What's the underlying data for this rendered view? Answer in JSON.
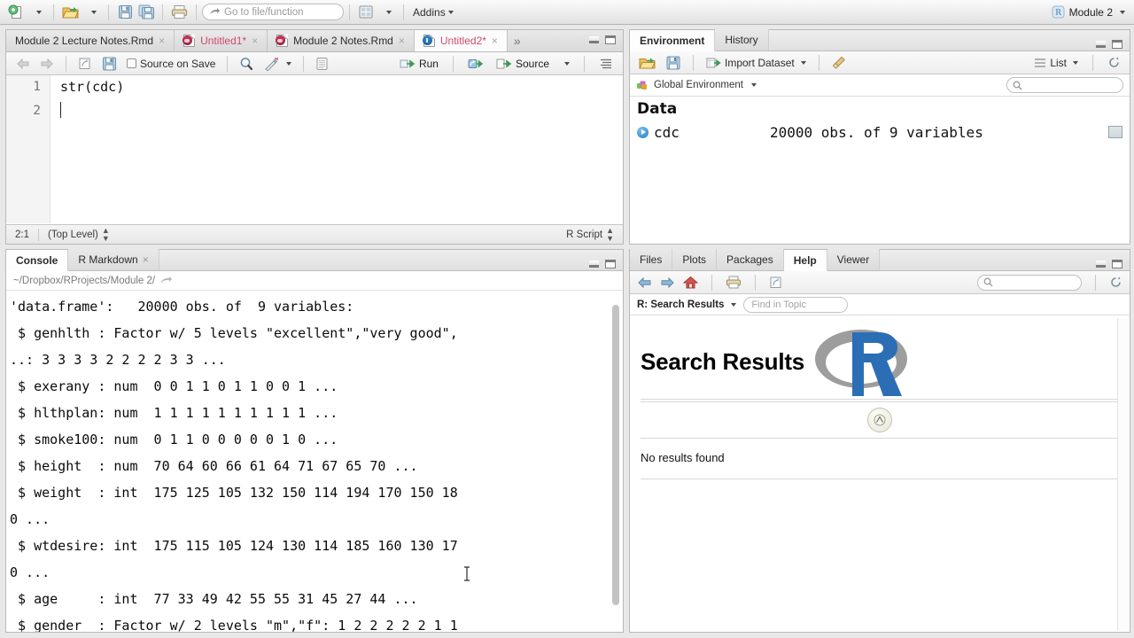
{
  "app": {
    "project_name": "Module 2",
    "addins_label": "Addins",
    "goto_placeholder": "Go to file/function"
  },
  "toolbar": {
    "new_file_icon": "new-file-icon",
    "open_file_icon": "open-folder-icon",
    "save_icon": "save-icon",
    "save_all_icon": "save-all-icon",
    "print_icon": "print-icon",
    "workspace_panes_icon": "pane-layout-icon"
  },
  "source": {
    "tabs": [
      {
        "label": "Module 2 Lecture Notes.Rmd",
        "icon": "rmd-icon",
        "active": false,
        "unsaved": false,
        "closeable": true
      },
      {
        "label": "Untitled1*",
        "icon": "rmd-icon",
        "active": false,
        "unsaved": true,
        "closeable": true
      },
      {
        "label": "Module 2 Notes.Rmd",
        "icon": "rmd-icon",
        "active": false,
        "unsaved": false,
        "closeable": true
      },
      {
        "label": "Untitled2*",
        "icon": "r-script-icon",
        "active": true,
        "unsaved": true,
        "closeable": true
      }
    ],
    "overflow_label": "»",
    "toolbar": {
      "back_icon": "back-arrow-icon",
      "forward_icon": "forward-arrow-icon",
      "popout_icon": "show-in-new-window-icon",
      "save_icon": "save-icon",
      "source_on_save_label": "Source on Save",
      "find_icon": "magnifier-icon",
      "code_tools_icon": "magic-wand-icon",
      "compile_report_icon": "notebook-icon",
      "run_label": "Run",
      "rerun_icon": "rerun-icon",
      "source_label": "Source",
      "outline_icon": "document-outline-icon"
    },
    "lines": [
      {
        "number": "1",
        "text": "str(cdc)"
      },
      {
        "number": "2",
        "text": ""
      }
    ],
    "status": {
      "cursor_position": "2:1",
      "scope": "(Top Level)",
      "file_type": "R Script"
    }
  },
  "console": {
    "tabs": [
      {
        "label": "Console",
        "active": true,
        "closeable": false
      },
      {
        "label": "R Markdown",
        "active": false,
        "closeable": true
      }
    ],
    "working_directory": "~/Dropbox/RProjects/Module 2/",
    "output_lines": [
      "'data.frame':   20000 obs. of  9 variables:",
      " $ genhlth : Factor w/ 5 levels \"excellent\",\"very good\",",
      "..: 3 3 3 3 2 2 2 2 3 3 ...",
      " $ exerany : num  0 0 1 1 0 1 1 0 0 1 ...",
      " $ hlthplan: num  1 1 1 1 1 1 1 1 1 1 ...",
      " $ smoke100: num  0 1 1 0 0 0 0 0 1 0 ...",
      " $ height  : num  70 64 60 66 61 64 71 67 65 70 ...",
      " $ weight  : int  175 125 105 132 150 114 194 170 150 18",
      "0 ...",
      " $ wtdesire: int  175 115 105 124 130 114 185 160 130 17",
      "0 ...",
      " $ age     : int  77 33 49 42 55 55 31 45 27 44 ...",
      " $ gender  : Factor w/ 2 levels \"m\",\"f\": 1 2 2 2 2 2 1 1"
    ]
  },
  "environment": {
    "tabs": [
      {
        "label": "Environment",
        "active": true
      },
      {
        "label": "History",
        "active": false
      }
    ],
    "toolbar": {
      "load_icon": "open-folder-icon",
      "save_icon": "save-icon",
      "import_dataset_label": "Import Dataset",
      "clear_icon": "broom-icon",
      "view_mode_label": "List",
      "refresh_icon": "refresh-icon"
    },
    "scope_label": "Global Environment",
    "search_placeholder": "",
    "section_title": "Data",
    "objects": [
      {
        "name": "cdc",
        "value": "20000 obs. of 9 variables",
        "expandable": true,
        "view_icon": "grid-view-icon"
      }
    ]
  },
  "help": {
    "tabs": [
      {
        "label": "Files",
        "active": false
      },
      {
        "label": "Plots",
        "active": false
      },
      {
        "label": "Packages",
        "active": false
      },
      {
        "label": "Help",
        "active": true
      },
      {
        "label": "Viewer",
        "active": false
      }
    ],
    "toolbar": {
      "back_icon": "back-arrow-icon",
      "forward_icon": "forward-arrow-icon",
      "home_icon": "home-icon",
      "print_icon": "print-icon",
      "popout_icon": "show-in-new-window-icon",
      "search_placeholder": "",
      "refresh_icon": "refresh-icon"
    },
    "topic_selector_label": "R: Search Results",
    "find_in_topic_placeholder": "Find in Topic",
    "page_title": "Search Results",
    "logo_alt": "r-logo",
    "up_arrow_icon": "scroll-to-top-icon",
    "body_text": "No results found"
  },
  "colors": {
    "accent_red": "#cf4a6c",
    "r_blue": "#2c6eb5",
    "r_gray": "#9d9d9d",
    "toolbar_bg": "#ededed",
    "pane_border": "#b9b9b9"
  }
}
